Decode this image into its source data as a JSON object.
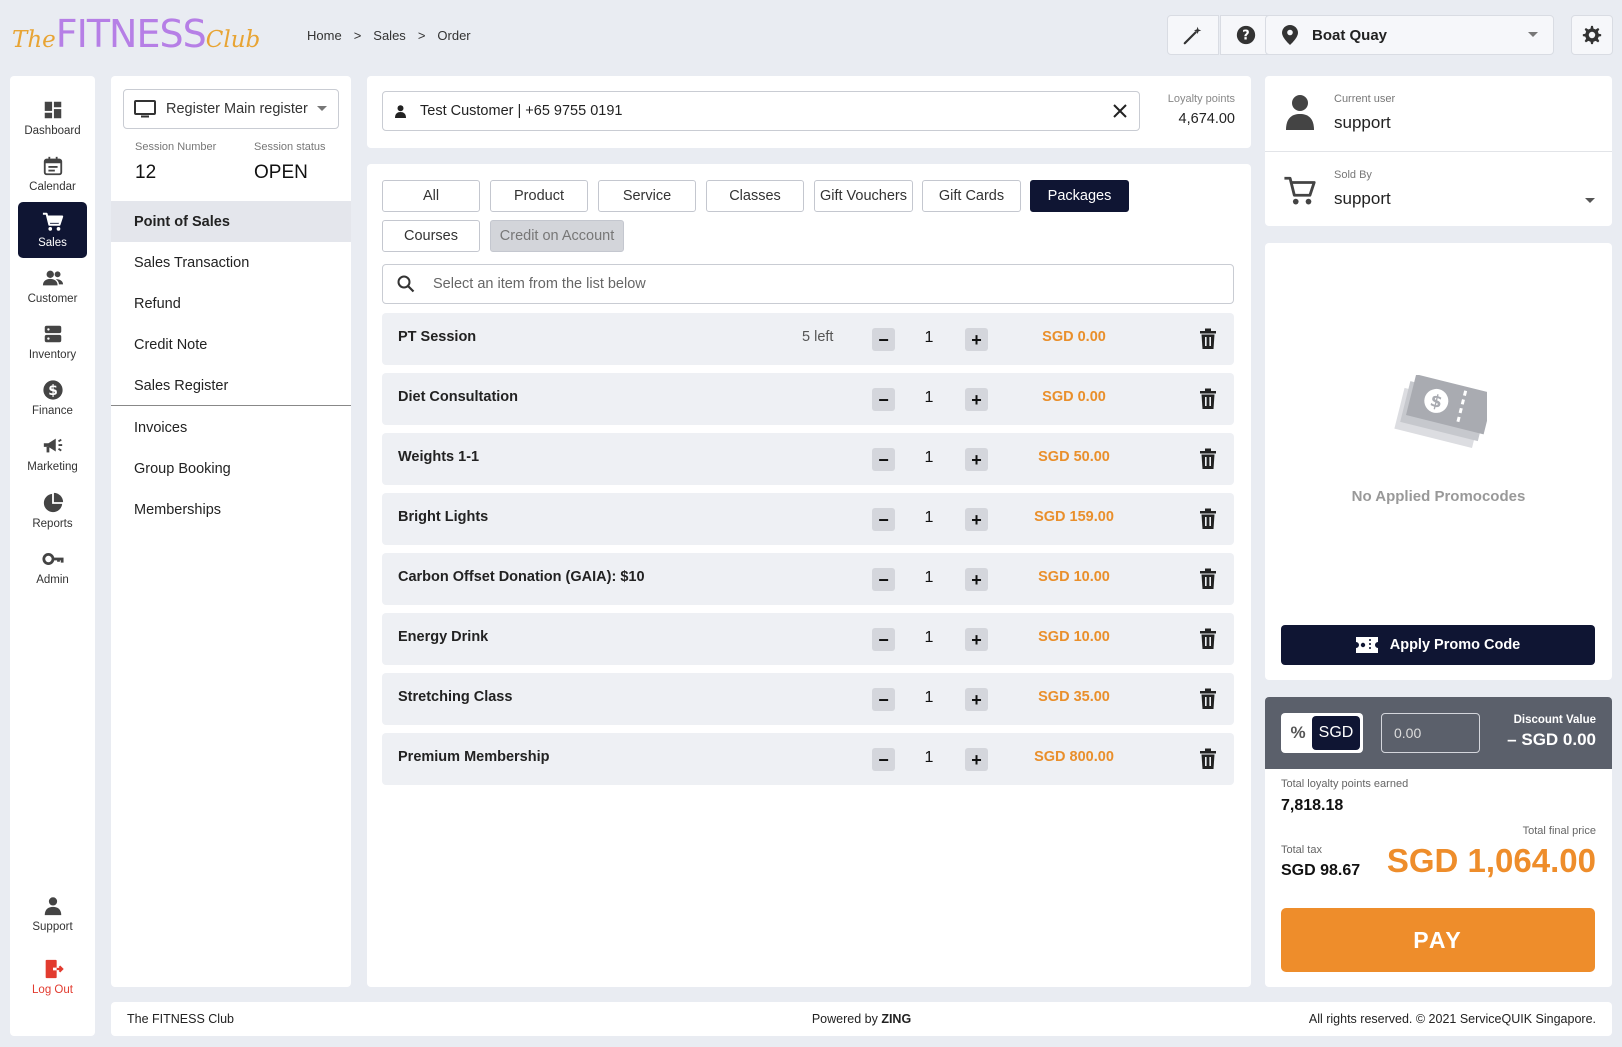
{
  "logo": {
    "the": "The",
    "fitness": "FITNESS",
    "club": "Club"
  },
  "breadcrumb": [
    "Home",
    ">",
    "Sales",
    ">",
    "Order"
  ],
  "header": {
    "location": "Boat Quay"
  },
  "nav": [
    {
      "label": "Dashboard",
      "icon": "dashboard-icon"
    },
    {
      "label": "Calendar",
      "icon": "calendar-icon"
    },
    {
      "label": "Sales",
      "icon": "cart-icon",
      "active": true
    },
    {
      "label": "Customer",
      "icon": "people-icon"
    },
    {
      "label": "Inventory",
      "icon": "inventory-icon"
    },
    {
      "label": "Finance",
      "icon": "dollar-icon"
    },
    {
      "label": "Marketing",
      "icon": "megaphone-icon"
    },
    {
      "label": "Reports",
      "icon": "pie-icon"
    },
    {
      "label": "Admin",
      "icon": "key-icon"
    }
  ],
  "nav_bottom": {
    "support": "Support",
    "logout": "Log Out"
  },
  "register": {
    "label": "Register Main register",
    "session_number_label": "Session Number",
    "session_number": "12",
    "session_status_label": "Session status",
    "session_status": "OPEN"
  },
  "subnav": {
    "group1": [
      "Point of Sales",
      "Sales Transaction",
      "Refund",
      "Credit Note",
      "Sales Register"
    ],
    "group2": [
      "Invoices",
      "Group Booking",
      "Memberships"
    ]
  },
  "customer": {
    "value": "Test Customer  |  +65 9755 0191",
    "loyalty_label": "Loyalty points",
    "loyalty_value": "4,674.00"
  },
  "tabs": [
    "All",
    "Product",
    "Service",
    "Classes",
    "Gift Vouchers",
    "Gift Cards",
    "Packages",
    "Courses",
    "Credit on Account"
  ],
  "search_placeholder": "Select an item from the list below",
  "items": [
    {
      "name": "PT Session",
      "left": "5 left",
      "qty": "1",
      "price": "SGD 0.00"
    },
    {
      "name": "Diet Consultation",
      "left": "",
      "qty": "1",
      "price": "SGD 0.00"
    },
    {
      "name": "Weights 1-1",
      "left": "",
      "qty": "1",
      "price": "SGD 50.00"
    },
    {
      "name": "Bright Lights",
      "left": "",
      "qty": "1",
      "price": "SGD 159.00"
    },
    {
      "name": "Carbon Offset Donation (GAIA): $10",
      "left": "",
      "qty": "1",
      "price": "SGD 10.00"
    },
    {
      "name": "Energy Drink",
      "left": "",
      "qty": "1",
      "price": "SGD 10.00"
    },
    {
      "name": "Stretching Class",
      "left": "",
      "qty": "1",
      "price": "SGD 35.00"
    },
    {
      "name": "Premium Membership",
      "left": "",
      "qty": "1",
      "price": "SGD 800.00"
    }
  ],
  "user": {
    "current_label": "Current user",
    "current_value": "support",
    "sold_label": "Sold By",
    "sold_value": "support"
  },
  "promo": {
    "empty": "No Applied Promocodes",
    "button": "Apply Promo Code"
  },
  "discount": {
    "pct_symbol": "%",
    "currency": "SGD",
    "input_value": "0.00",
    "value_label": "Discount Value",
    "value": "– SGD 0.00"
  },
  "totals": {
    "loyalty_earned_label": "Total loyalty points earned",
    "loyalty_earned": "7,818.18",
    "tax_label": "Total tax",
    "tax": "SGD 98.67",
    "final_label": "Total final price",
    "final": "SGD 1,064.00",
    "pay": "PAY"
  },
  "footer": {
    "left": "The FITNESS Club",
    "center_prefix": "Powered by ",
    "center_brand": "ZING",
    "right": "All rights reserved. © 2021 ServiceQUIK Singapore."
  },
  "colors": {
    "primary": "#0f1533",
    "accent": "#ee8d2b",
    "logo_purple": "#b67fe6",
    "logo_orange": "#e8a434",
    "logout_red": "#e23b2f"
  }
}
